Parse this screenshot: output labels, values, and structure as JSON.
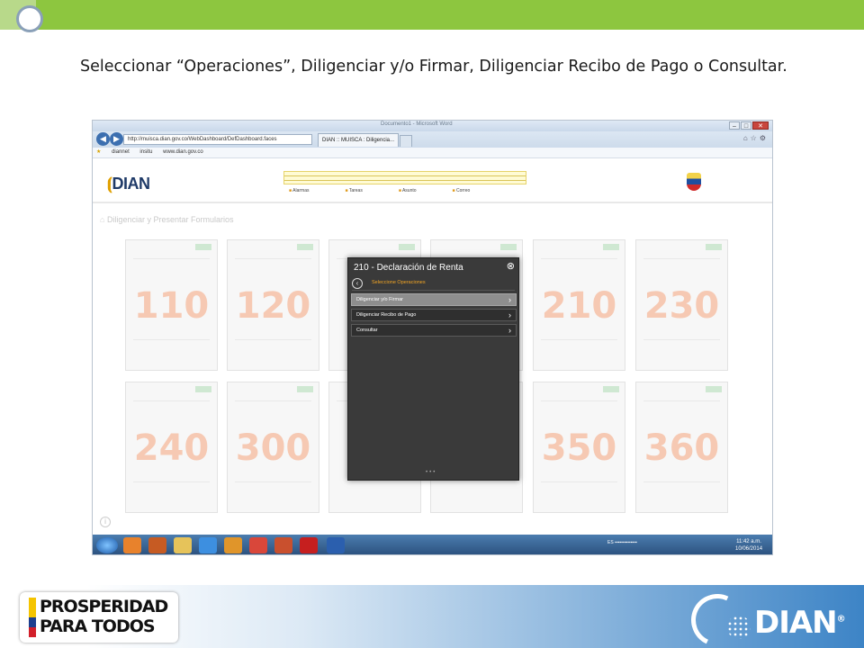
{
  "instruction": "Seleccionar  “Operaciones”,  Diligenciar y/o Firmar, Diligenciar Recibo de Pago o Consultar.",
  "browser": {
    "window_title": "Documento1 - Microsoft Word",
    "url": "http://muisca.dian.gov.co/WebDashboard/DefDashboard.faces",
    "tab_label": "DIAN :: MUISCA : Diligencia...",
    "favorites": [
      "diannet",
      "insitu",
      "www.dian.gov.co"
    ]
  },
  "app": {
    "logo": "DIAN",
    "menu": [
      "Alarmas",
      "Tareas",
      "Asunto",
      "Correo"
    ],
    "section_title": "Diligenciar y Presentar Formularios"
  },
  "forms": [
    "110",
    "120",
    "210",
    "230",
    "240",
    "300",
    "350",
    "360"
  ],
  "modal": {
    "title": "210 - Declaración de Renta",
    "subtitle": "Seleccione Operaciones",
    "operations": [
      {
        "label": "Diligenciar y/o Firmar",
        "active": true
      },
      {
        "label": "Diligenciar Recibo de Pago",
        "active": false
      },
      {
        "label": "Consultar",
        "active": false
      }
    ]
  },
  "taskbar": {
    "language": "ES",
    "time": "11:42 a.m.",
    "date": "10/06/2014"
  },
  "footer": {
    "left_logo_line1": "PROSPERIDAD",
    "left_logo_line2": "PARA TODOS",
    "right_logo": "DIAN"
  },
  "colors": {
    "accent_green": "#8dc63f",
    "dian_blue": "#1f3a68",
    "modal_bg": "#3a3a3a",
    "modal_sub": "#f5a623"
  }
}
